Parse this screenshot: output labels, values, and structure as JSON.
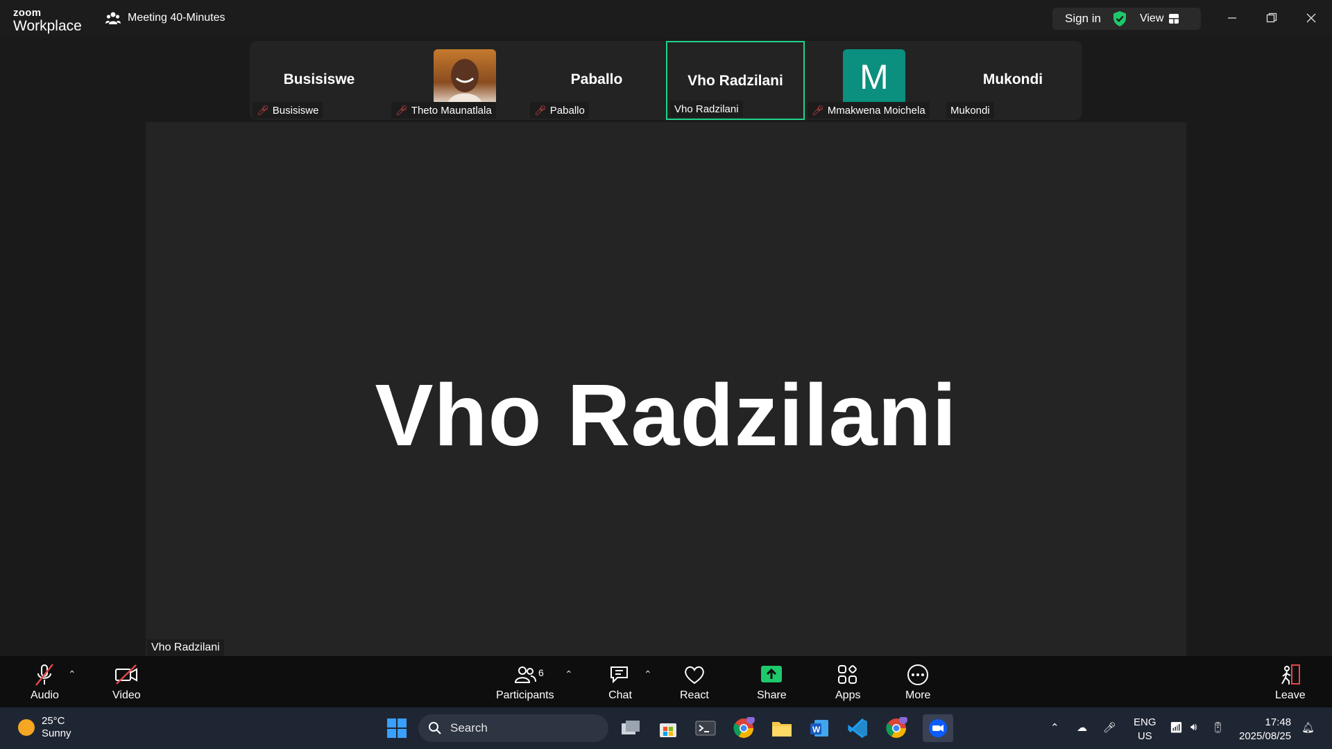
{
  "titlebar": {
    "logo_top": "zoom",
    "logo_bottom": "Workplace",
    "meeting_title": "Meeting 40-Minutes",
    "signin_label": "Sign in",
    "view_label": "View"
  },
  "thumbnails": [
    {
      "big_name": "Busisiswe",
      "label": "Busisiswe",
      "muted": true,
      "avatar": "none"
    },
    {
      "big_name": "",
      "label": "Theto Maunatlala",
      "muted": true,
      "avatar": "photo"
    },
    {
      "big_name": "Paballo",
      "label": "Paballo",
      "muted": true,
      "avatar": "none"
    },
    {
      "big_name": "Vho Radzilani",
      "label": "Vho Radzilani",
      "muted": false,
      "avatar": "none",
      "active": true
    },
    {
      "big_name": "",
      "label": "Mmakwena Moichela",
      "muted": true,
      "avatar": "letter",
      "avatar_letter": "M"
    },
    {
      "big_name": "Mukondi",
      "label": "Mukondi",
      "muted": false,
      "avatar": "none"
    }
  ],
  "main_video": {
    "display_name": "Vho Radzilani",
    "label": "Vho Radzilani"
  },
  "toolbar": {
    "audio": "Audio",
    "video": "Video",
    "participants": "Participants",
    "participants_count": "6",
    "chat": "Chat",
    "react": "React",
    "share": "Share",
    "apps": "Apps",
    "more": "More",
    "leave": "Leave"
  },
  "taskbar": {
    "weather_temp": "25°C",
    "weather_desc": "Sunny",
    "search_placeholder": "Search",
    "lang_top": "ENG",
    "lang_bottom": "US",
    "time": "17:48",
    "date": "2025/08/25"
  },
  "colors": {
    "active_border": "#1ed58a",
    "share_green": "#1ec96b",
    "mute_red": "#e5484d",
    "leave_red": "#e5484d",
    "zoom_blue": "#0b5cff"
  }
}
